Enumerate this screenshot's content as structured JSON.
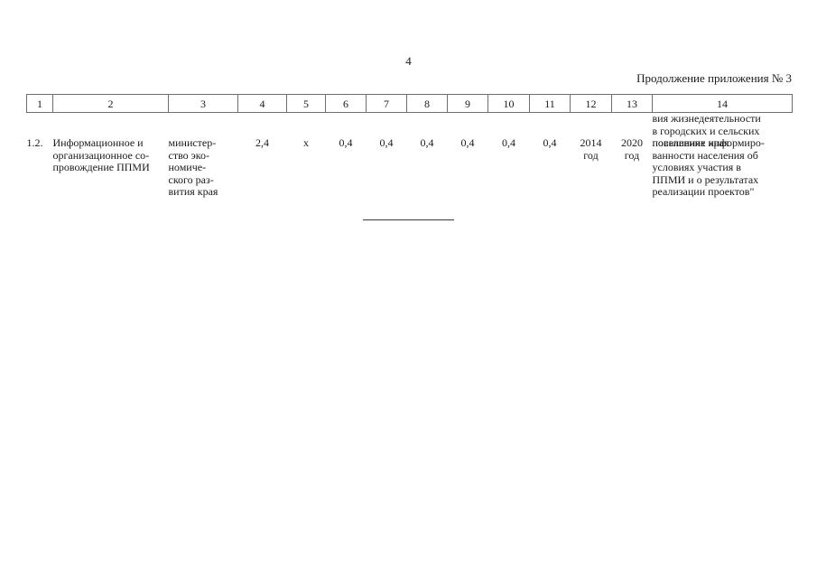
{
  "document": {
    "page_number": "4",
    "continuation_note": "Продолжение приложения № 3"
  },
  "table": {
    "column_headers": [
      "1",
      "2",
      "3",
      "4",
      "5",
      "6",
      "7",
      "8",
      "9",
      "10",
      "11",
      "12",
      "13",
      "14"
    ],
    "header_overflow_col14": [
      "вия жизнедеятельности",
      "в городских и сельских",
      "поселениях края"
    ],
    "row": {
      "item_number": "1.2.",
      "name_lines": [
        "Информационное и",
        "организационное со-",
        "провождение ППМИ"
      ],
      "executor_lines": [
        "министер-",
        "ство эко-",
        "номиче-",
        "ского раз-",
        "вития края"
      ],
      "total": "2,4",
      "col5": "x",
      "col6": "0,4",
      "col7": "0,4",
      "col8": "0,4",
      "col9": "0,4",
      "col10": "0,4",
      "col11": "0,4",
      "start_year_value": "2014",
      "start_year_unit": "год",
      "end_year_value": "2020",
      "end_year_unit": "год",
      "result_lines": [
        "повышение информиро-",
        "ванности населения об",
        "условиях участия в",
        "ППМИ и о результатах",
        "реализации проектов\""
      ]
    }
  }
}
